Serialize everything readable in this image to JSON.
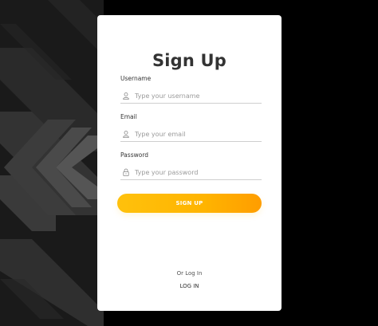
{
  "form": {
    "title": "Sign Up",
    "fields": [
      {
        "label": "Username",
        "placeholder": "Type your username",
        "icon": "user-icon"
      },
      {
        "label": "Email",
        "placeholder": "Type your email",
        "icon": "user-icon"
      },
      {
        "label": "Password",
        "placeholder": "Type your password",
        "icon": "lock-icon"
      }
    ],
    "submit_label": "SIGN UP",
    "alt_prompt": "Or Log In",
    "login_label": "LOG IN"
  },
  "colors": {
    "accent": "#ffb400",
    "background": "#000000",
    "card": "#ffffff"
  }
}
